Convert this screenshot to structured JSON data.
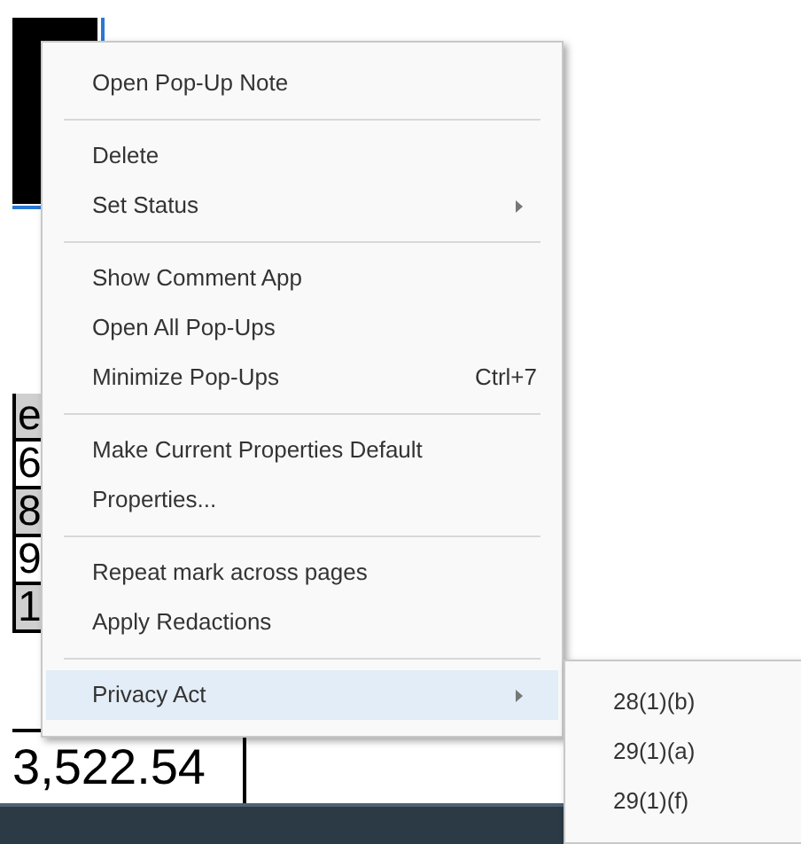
{
  "document": {
    "cells": [
      {
        "text": "e",
        "shaded": true
      },
      {
        "text": "6",
        "shaded": false
      },
      {
        "text": "8",
        "shaded": true
      },
      {
        "text": "9",
        "shaded": false
      },
      {
        "text": "1",
        "shaded": true
      }
    ],
    "total": "3,522.54"
  },
  "context_menu": {
    "groups": [
      [
        {
          "label": "Open Pop-Up Note",
          "submenu": false,
          "selected": false
        }
      ],
      [
        {
          "label": "Delete",
          "submenu": false,
          "selected": false
        },
        {
          "label": "Set Status",
          "submenu": true,
          "selected": false
        }
      ],
      [
        {
          "label": "Show Comment App",
          "submenu": false,
          "selected": false
        },
        {
          "label": "Open All Pop-Ups",
          "submenu": false,
          "selected": false
        },
        {
          "label": "Minimize Pop-Ups",
          "shortcut": "Ctrl+7",
          "submenu": false,
          "selected": false
        }
      ],
      [
        {
          "label": "Make Current Properties Default",
          "submenu": false,
          "selected": false
        },
        {
          "label": "Properties...",
          "submenu": false,
          "selected": false
        }
      ],
      [
        {
          "label": "Repeat mark across pages",
          "submenu": false,
          "selected": false
        },
        {
          "label": "Apply Redactions",
          "submenu": false,
          "selected": false
        }
      ],
      [
        {
          "label": "Privacy Act",
          "submenu": true,
          "selected": true
        }
      ]
    ]
  },
  "submenu": {
    "items": [
      {
        "label": "28(1)(b)"
      },
      {
        "label": "29(1)(a)"
      },
      {
        "label": "29(1)(f)"
      }
    ]
  }
}
